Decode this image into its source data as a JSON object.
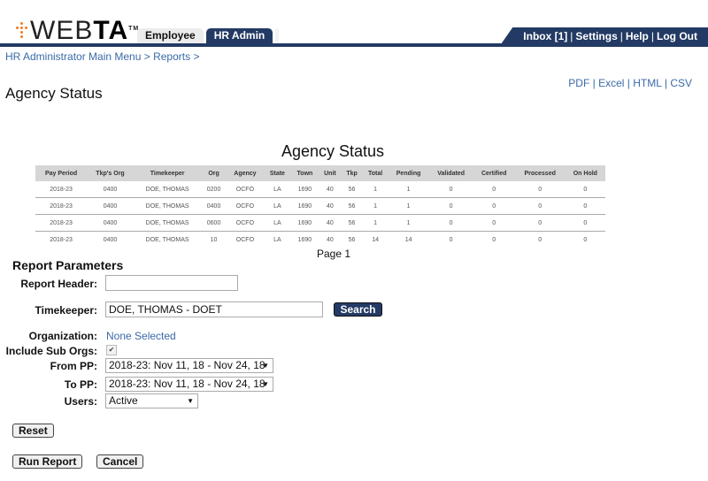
{
  "app": {
    "logo_text_light": "WEB",
    "logo_text_bold": "TA",
    "logo_tm": "TM"
  },
  "tabs": [
    {
      "label": "Employee",
      "active": false
    },
    {
      "label": "HR Admin",
      "active": true
    }
  ],
  "user_nav": {
    "inbox": "Inbox [1]",
    "settings": "Settings",
    "help": "Help",
    "logout": "Log Out",
    "separator": "|"
  },
  "breadcrumb": {
    "items": [
      "HR Administrator Main Menu",
      "Reports"
    ],
    "separator": ">"
  },
  "page_title": "Agency Status",
  "exports": {
    "pdf": "PDF",
    "excel": "Excel",
    "html": "HTML",
    "csv": "CSV",
    "separator": "|"
  },
  "report": {
    "title": "Agency Status",
    "columns": [
      "Pay Period",
      "Tkp's Org",
      "Timekeeper",
      "Org",
      "Agency",
      "State",
      "Town",
      "Unit",
      "Tkp",
      "Total",
      "Pending",
      "Validated",
      "Certified",
      "Processed",
      "On Hold"
    ],
    "rows": [
      [
        "2018-23",
        "0400",
        "DOE, THOMAS",
        "0200",
        "OCFO",
        "LA",
        "1690",
        "40",
        "56",
        "1",
        "1",
        "0",
        "0",
        "0",
        "0"
      ],
      [
        "2018-23",
        "0400",
        "DOE, THOMAS",
        "0400",
        "OCFO",
        "LA",
        "1690",
        "40",
        "56",
        "1",
        "1",
        "0",
        "0",
        "0",
        "0"
      ],
      [
        "2018-23",
        "0400",
        "DOE, THOMAS",
        "0600",
        "OCFO",
        "LA",
        "1690",
        "40",
        "56",
        "1",
        "1",
        "0",
        "0",
        "0",
        "0"
      ],
      [
        "2018-23",
        "0400",
        "DOE, THOMAS",
        "10",
        "OCFO",
        "LA",
        "1690",
        "40",
        "56",
        "14",
        "14",
        "0",
        "0",
        "0",
        "0"
      ]
    ],
    "page_label": "Page 1"
  },
  "params": {
    "title": "Report Parameters",
    "report_header_label": "Report Header:",
    "report_header_value": "",
    "timekeeper_label": "Timekeeper:",
    "timekeeper_value": "DOE, THOMAS - DOET",
    "search_label": "Search",
    "organization_label": "Organization:",
    "organization_value": "None Selected",
    "include_sub_orgs_label": "Include Sub Orgs:",
    "include_sub_orgs_checked": true,
    "checkmark": "✔",
    "from_pp_label": "From PP:",
    "from_pp_value": "2018-23: Nov 11, 18 - Nov 24, 18",
    "to_pp_label": "To PP:",
    "to_pp_value": "2018-23: Nov 11, 18 - Nov 24, 18",
    "users_label": "Users:",
    "users_value": "Active",
    "dropdown_arrow": "▼"
  },
  "buttons": {
    "reset": "Reset",
    "run_report": "Run Report",
    "cancel": "Cancel"
  },
  "colors": {
    "brand_navy": "#233a64",
    "logo_orange": "#f47b20",
    "link_blue": "#3a6aa8"
  }
}
